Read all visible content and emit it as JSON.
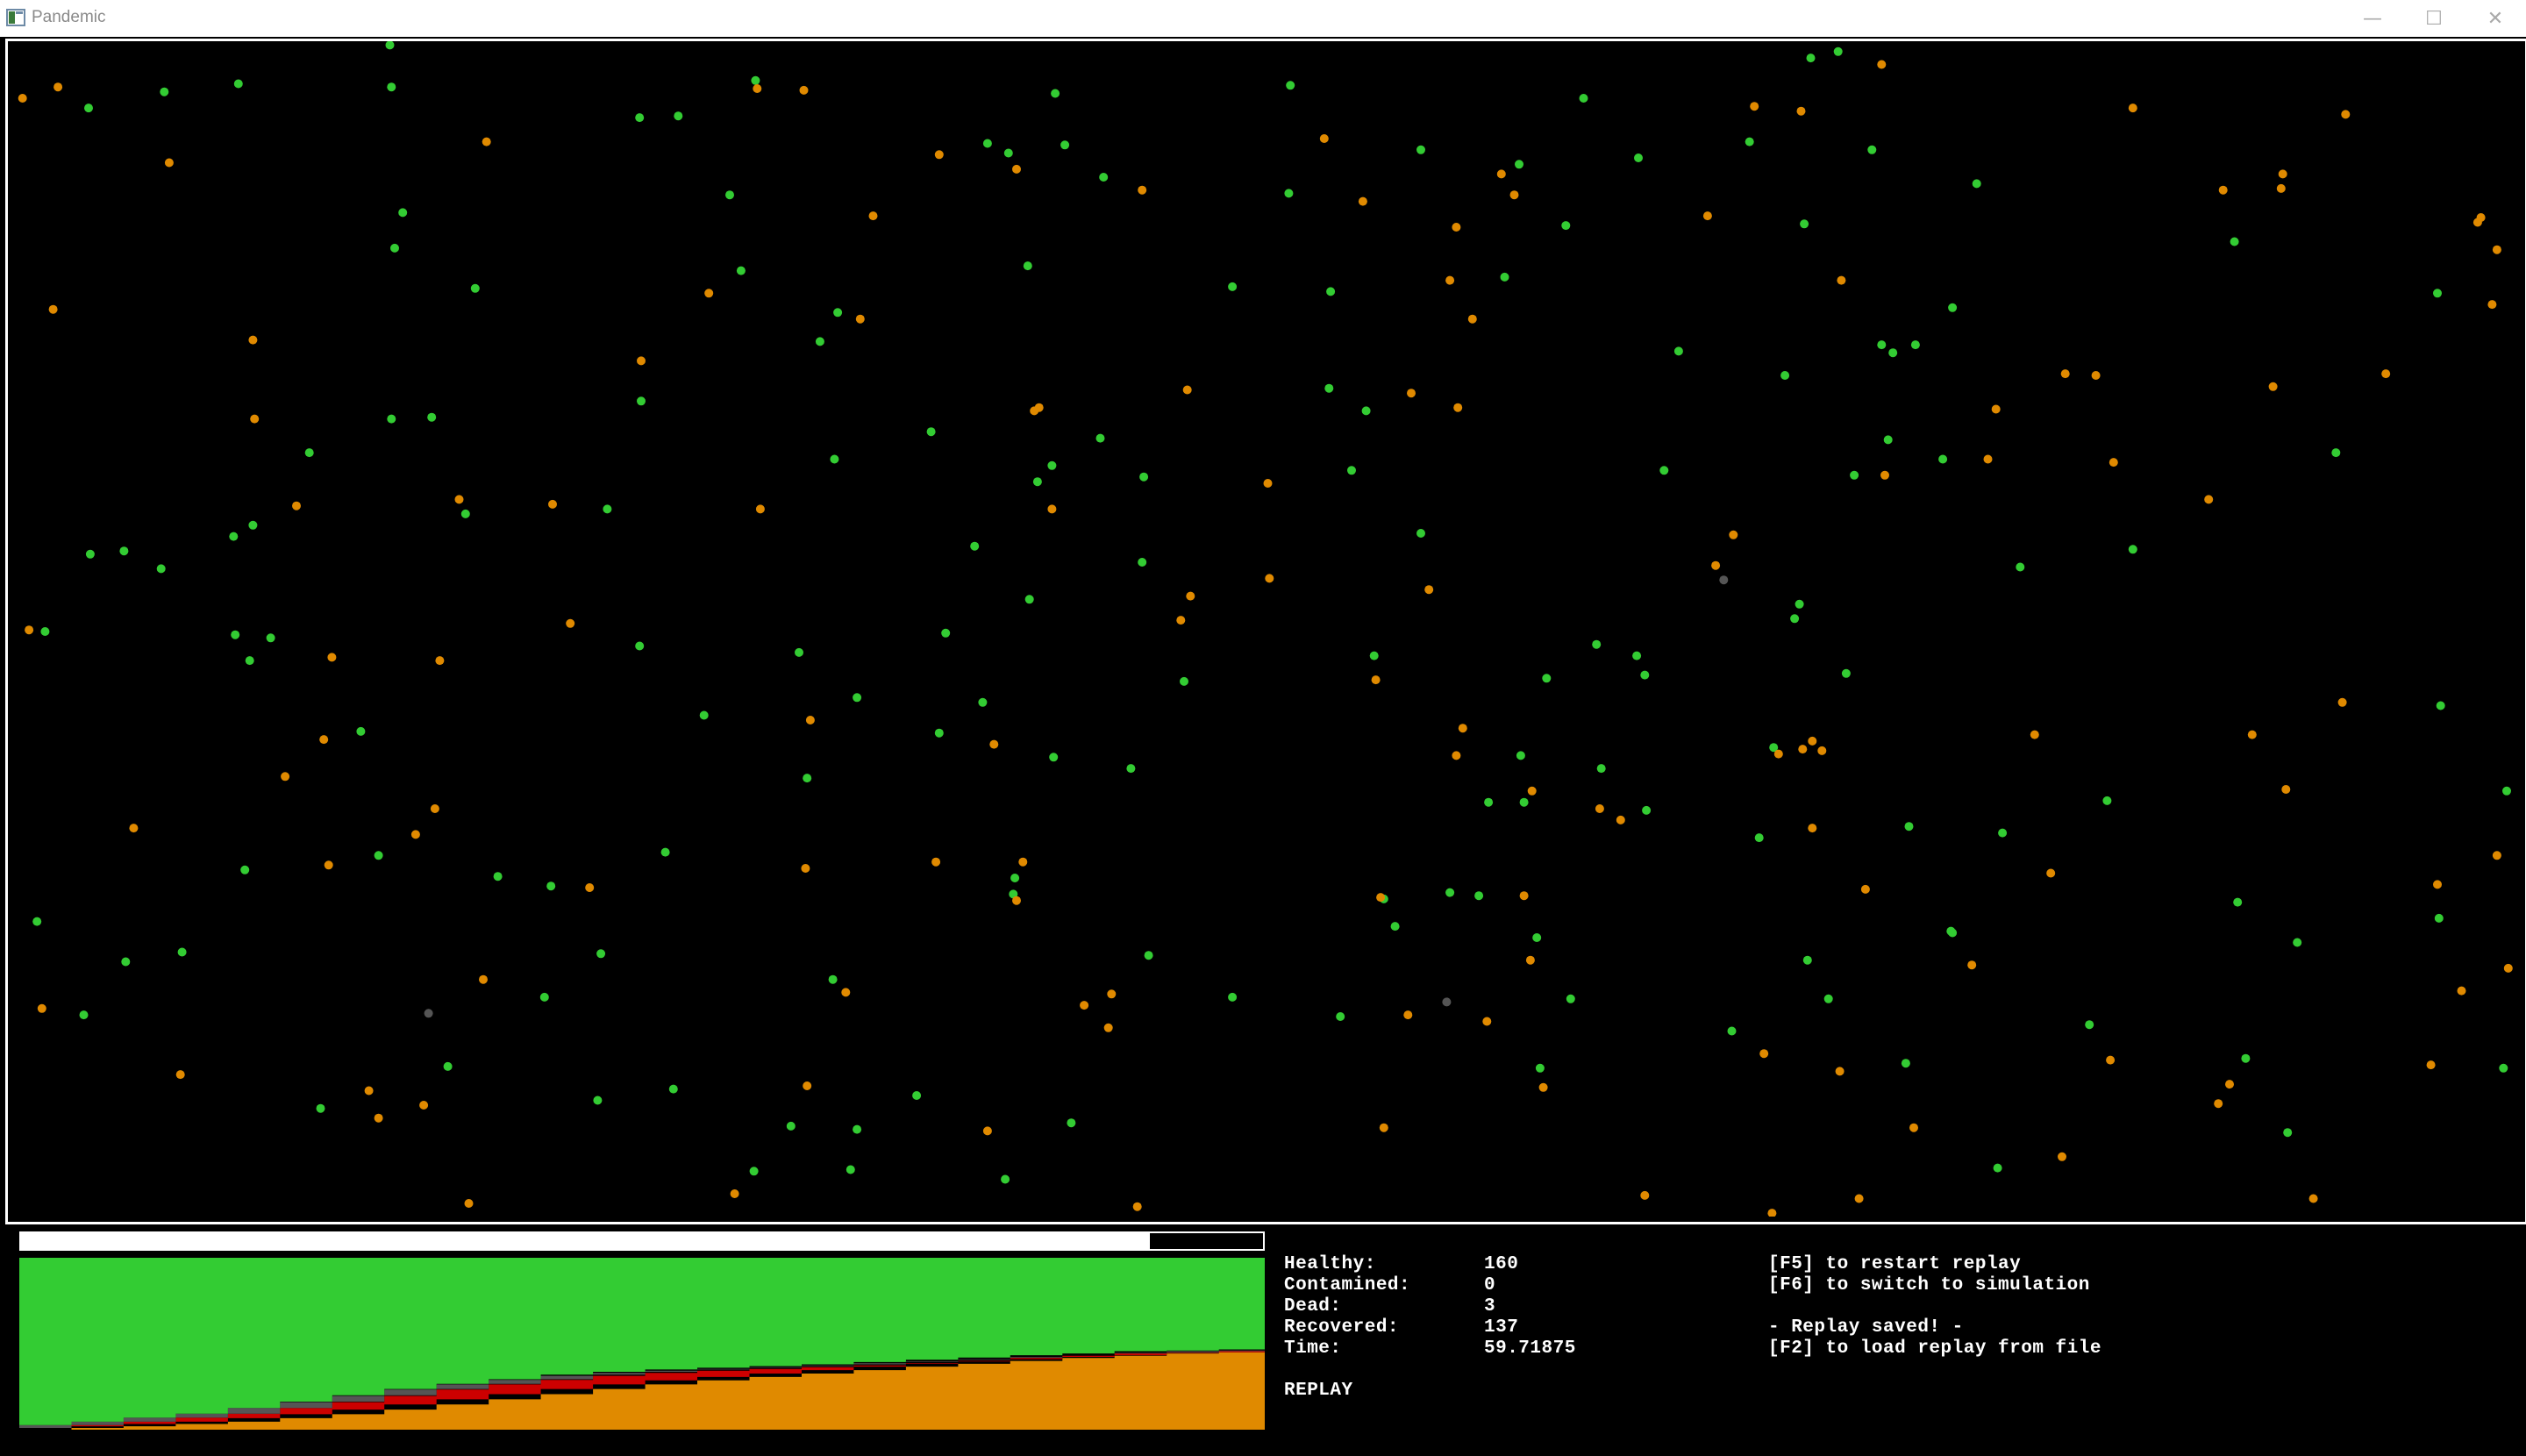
{
  "window": {
    "title": "Pandemic",
    "controls": [
      "minimize",
      "maximize",
      "close"
    ]
  },
  "colors": {
    "healthy": "#33cc33",
    "contaminated": "#cc0000",
    "recovered": "#e08a00",
    "dead": "#555555",
    "background": "#000000",
    "progress": "#ffffff"
  },
  "replay_progress": 0.909,
  "stats": [
    {
      "label": "Healthy:",
      "value": "160"
    },
    {
      "label": "Contamined:",
      "value": "0"
    },
    {
      "label": "Dead:",
      "value": "3"
    },
    {
      "label": "Recovered:",
      "value": "137"
    },
    {
      "label": "Time:",
      "value": "59.71875"
    }
  ],
  "mode_label": "REPLAY",
  "hints": {
    "restart": "[F5] to restart replay",
    "switch": "[F6] to switch to simulation",
    "saved": "- Replay saved! -",
    "load": "[F2] to load replay from file"
  },
  "chart_data": {
    "type": "area",
    "stacked": true,
    "total_population": 300,
    "x_label": "",
    "y_label": "",
    "x": [
      0,
      2.5,
      5,
      7.5,
      10,
      12.5,
      15,
      17.5,
      20,
      22.5,
      25,
      27.5,
      30,
      32.5,
      35,
      37.5,
      40,
      42.5,
      45,
      47.5,
      50,
      52.5,
      55,
      57.5,
      59.7
    ],
    "series": [
      {
        "name": "recovered",
        "values": [
          0,
          3,
          6,
          10,
          14,
          20,
          27,
          35,
          44,
          53,
          62,
          71,
          79,
          86,
          92,
          98,
          104,
          110,
          115,
          120,
          125,
          129,
          133,
          135,
          137
        ]
      },
      {
        "name": "contaminated",
        "values": [
          3,
          5,
          8,
          11,
          14,
          18,
          21,
          24,
          26,
          26,
          25,
          23,
          20,
          17,
          14,
          11,
          8,
          6,
          4,
          3,
          2,
          1,
          1,
          0,
          0
        ]
      },
      {
        "name": "dead",
        "values": [
          0,
          0,
          0,
          0,
          0,
          0,
          1,
          1,
          1,
          1,
          1,
          2,
          2,
          2,
          2,
          2,
          2,
          2,
          3,
          3,
          3,
          3,
          3,
          3,
          3
        ]
      },
      {
        "name": "healthy",
        "values": [
          297,
          292,
          286,
          279,
          272,
          262,
          251,
          240,
          229,
          220,
          212,
          204,
          199,
          195,
          192,
          189,
          186,
          182,
          178,
          174,
          170,
          167,
          163,
          162,
          160
        ]
      }
    ]
  },
  "particles": {
    "healthy": [
      [
        242,
        28
      ],
      [
        243,
        54
      ],
      [
        148,
        52
      ],
      [
        102,
        57
      ],
      [
        55,
        67
      ],
      [
        469,
        50
      ],
      [
        655,
        58
      ],
      [
        801,
        53
      ],
      [
        1124,
        36
      ],
      [
        1141,
        32
      ],
      [
        983,
        61
      ],
      [
        397,
        73
      ],
      [
        421,
        72
      ],
      [
        613,
        89
      ],
      [
        626,
        95
      ],
      [
        661,
        90
      ],
      [
        685,
        110
      ],
      [
        882,
        93
      ],
      [
        943,
        102
      ],
      [
        1017,
        98
      ],
      [
        1086,
        88
      ],
      [
        1162,
        93
      ],
      [
        453,
        121
      ],
      [
        250,
        132
      ],
      [
        245,
        154
      ],
      [
        800,
        120
      ],
      [
        972,
        140
      ],
      [
        1120,
        139
      ],
      [
        1227,
        114
      ],
      [
        1387,
        150
      ],
      [
        295,
        179
      ],
      [
        460,
        168
      ],
      [
        638,
        165
      ],
      [
        765,
        178
      ],
      [
        826,
        181
      ],
      [
        934,
        172
      ],
      [
        1513,
        182
      ],
      [
        520,
        194
      ],
      [
        509,
        212
      ],
      [
        1042,
        218
      ],
      [
        1108,
        233
      ],
      [
        1168,
        214
      ],
      [
        1175,
        219
      ],
      [
        1189,
        214
      ],
      [
        1212,
        191
      ],
      [
        398,
        249
      ],
      [
        243,
        260
      ],
      [
        268,
        259
      ],
      [
        578,
        268
      ],
      [
        825,
        241
      ],
      [
        848,
        255
      ],
      [
        683,
        272
      ],
      [
        1172,
        273
      ],
      [
        192,
        281
      ],
      [
        518,
        285
      ],
      [
        653,
        289
      ],
      [
        644,
        299
      ],
      [
        710,
        296
      ],
      [
        839,
        292
      ],
      [
        1033,
        292
      ],
      [
        1151,
        295
      ],
      [
        1206,
        285
      ],
      [
        1450,
        281
      ],
      [
        289,
        319
      ],
      [
        377,
        316
      ],
      [
        157,
        326
      ],
      [
        145,
        333
      ],
      [
        77,
        342
      ],
      [
        56,
        344
      ],
      [
        100,
        353
      ],
      [
        605,
        339
      ],
      [
        709,
        349
      ],
      [
        882,
        331
      ],
      [
        1254,
        352
      ],
      [
        1324,
        341
      ],
      [
        28,
        392
      ],
      [
        146,
        394
      ],
      [
        168,
        396
      ],
      [
        155,
        410
      ],
      [
        397,
        401
      ],
      [
        496,
        405
      ],
      [
        587,
        393
      ],
      [
        639,
        372
      ],
      [
        1117,
        375
      ],
      [
        1114,
        384
      ],
      [
        991,
        400
      ],
      [
        1016,
        407
      ],
      [
        853,
        407
      ],
      [
        1021,
        419
      ],
      [
        960,
        421
      ],
      [
        735,
        423
      ],
      [
        1146,
        418
      ],
      [
        437,
        444
      ],
      [
        532,
        433
      ],
      [
        610,
        436
      ],
      [
        583,
        455
      ],
      [
        224,
        454
      ],
      [
        654,
        470
      ],
      [
        702,
        477
      ],
      [
        944,
        469
      ],
      [
        1101,
        464
      ],
      [
        1515,
        438
      ],
      [
        501,
        483
      ],
      [
        994,
        477
      ],
      [
        946,
        498
      ],
      [
        924,
        498
      ],
      [
        1022,
        503
      ],
      [
        1308,
        497
      ],
      [
        1556,
        491
      ],
      [
        235,
        531
      ],
      [
        413,
        529
      ],
      [
        152,
        540
      ],
      [
        309,
        544
      ],
      [
        342,
        550
      ],
      [
        630,
        545
      ],
      [
        629,
        555
      ],
      [
        1092,
        520
      ],
      [
        1185,
        513
      ],
      [
        1243,
        517
      ],
      [
        900,
        554
      ],
      [
        918,
        556
      ],
      [
        859,
        558
      ],
      [
        866,
        575
      ],
      [
        23,
        572
      ],
      [
        78,
        597
      ],
      [
        113,
        591
      ],
      [
        373,
        592
      ],
      [
        517,
        608
      ],
      [
        713,
        593
      ],
      [
        954,
        582
      ],
      [
        1122,
        596
      ],
      [
        1211,
        578
      ],
      [
        1212,
        579
      ],
      [
        1389,
        560
      ],
      [
        1514,
        570
      ],
      [
        1426,
        585
      ],
      [
        52,
        630
      ],
      [
        338,
        619
      ],
      [
        765,
        619
      ],
      [
        832,
        631
      ],
      [
        975,
        620
      ],
      [
        1135,
        620
      ],
      [
        1075,
        640
      ],
      [
        1297,
        636
      ],
      [
        278,
        662
      ],
      [
        199,
        688
      ],
      [
        371,
        683
      ],
      [
        418,
        676
      ],
      [
        569,
        680
      ],
      [
        956,
        663
      ],
      [
        1183,
        660
      ],
      [
        1394,
        657
      ],
      [
        1554,
        663
      ],
      [
        491,
        699
      ],
      [
        532,
        701
      ],
      [
        665,
        697
      ],
      [
        1420,
        703
      ],
      [
        468,
        727
      ],
      [
        528,
        726
      ],
      [
        624,
        732
      ],
      [
        1240,
        725
      ]
    ],
    "recovered": [
      [
        14,
        61
      ],
      [
        36,
        54
      ],
      [
        470,
        55
      ],
      [
        499,
        56
      ],
      [
        105,
        101
      ],
      [
        302,
        88
      ],
      [
        583,
        96
      ],
      [
        631,
        105
      ],
      [
        709,
        118
      ],
      [
        822,
        86
      ],
      [
        846,
        125
      ],
      [
        932,
        108
      ],
      [
        940,
        121
      ],
      [
        1089,
        66
      ],
      [
        1118,
        69
      ],
      [
        1168,
        40
      ],
      [
        1324,
        67
      ],
      [
        1456,
        71
      ],
      [
        1060,
        134
      ],
      [
        1380,
        118
      ],
      [
        1417,
        108
      ],
      [
        1416,
        117
      ],
      [
        1540,
        135
      ],
      [
        1538,
        138
      ],
      [
        1550,
        155
      ],
      [
        33,
        192
      ],
      [
        157,
        211
      ],
      [
        440,
        182
      ],
      [
        542,
        134
      ],
      [
        534,
        198
      ],
      [
        398,
        224
      ],
      [
        904,
        141
      ],
      [
        900,
        174
      ],
      [
        914,
        198
      ],
      [
        1143,
        174
      ],
      [
        1547,
        189
      ],
      [
        158,
        260
      ],
      [
        642,
        255
      ],
      [
        645,
        253
      ],
      [
        737,
        242
      ],
      [
        876,
        244
      ],
      [
        905,
        253
      ],
      [
        1239,
        254
      ],
      [
        1282,
        232
      ],
      [
        1301,
        233
      ],
      [
        1411,
        240
      ],
      [
        1481,
        232
      ],
      [
        184,
        314
      ],
      [
        285,
        310
      ],
      [
        343,
        313
      ],
      [
        472,
        316
      ],
      [
        653,
        316
      ],
      [
        787,
        300
      ],
      [
        1170,
        295
      ],
      [
        1234,
        285
      ],
      [
        1312,
        287
      ],
      [
        1371,
        310
      ],
      [
        1065,
        351
      ],
      [
        1076,
        332
      ],
      [
        788,
        359
      ],
      [
        887,
        366
      ],
      [
        739,
        370
      ],
      [
        18,
        391
      ],
      [
        354,
        387
      ],
      [
        733,
        385
      ],
      [
        206,
        408
      ],
      [
        273,
        410
      ],
      [
        854,
        422
      ],
      [
        503,
        447
      ],
      [
        617,
        462
      ],
      [
        908,
        452
      ],
      [
        904,
        469
      ],
      [
        1125,
        460
      ],
      [
        1131,
        466
      ],
      [
        1119,
        465
      ],
      [
        1104,
        468
      ],
      [
        1263,
        456
      ],
      [
        1398,
        456
      ],
      [
        1454,
        436
      ],
      [
        1419,
        490
      ],
      [
        201,
        459
      ],
      [
        177,
        482
      ],
      [
        951,
        491
      ],
      [
        993,
        502
      ],
      [
        1006,
        509
      ],
      [
        83,
        514
      ],
      [
        270,
        502
      ],
      [
        258,
        518
      ],
      [
        204,
        537
      ],
      [
        366,
        551
      ],
      [
        500,
        539
      ],
      [
        581,
        535
      ],
      [
        635,
        535
      ],
      [
        631,
        559
      ],
      [
        857,
        557
      ],
      [
        946,
        556
      ],
      [
        1125,
        514
      ],
      [
        1158,
        552
      ],
      [
        1273,
        542
      ],
      [
        1513,
        549
      ],
      [
        1550,
        531
      ],
      [
        300,
        608
      ],
      [
        525,
        616
      ],
      [
        673,
        624
      ],
      [
        690,
        617
      ],
      [
        688,
        638
      ],
      [
        874,
        630
      ],
      [
        923,
        634
      ],
      [
        950,
        596
      ],
      [
        26,
        626
      ],
      [
        1224,
        599
      ],
      [
        1528,
        615
      ],
      [
        1557,
        601
      ],
      [
        112,
        667
      ],
      [
        229,
        677
      ],
      [
        235,
        694
      ],
      [
        263,
        686
      ],
      [
        501,
        674
      ],
      [
        958,
        675
      ],
      [
        1095,
        654
      ],
      [
        1142,
        665
      ],
      [
        1310,
        658
      ],
      [
        1384,
        673
      ],
      [
        1377,
        685
      ],
      [
        1509,
        661
      ],
      [
        1188,
        700
      ],
      [
        613,
        702
      ],
      [
        859,
        700
      ],
      [
        1280,
        718
      ],
      [
        291,
        747
      ],
      [
        456,
        741
      ],
      [
        706,
        749
      ],
      [
        1021,
        742
      ],
      [
        1100,
        753
      ],
      [
        1154,
        744
      ],
      [
        1436,
        744
      ]
    ],
    "dead": [
      [
        1070,
        360
      ],
      [
        266,
        629
      ],
      [
        898,
        622
      ]
    ]
  }
}
